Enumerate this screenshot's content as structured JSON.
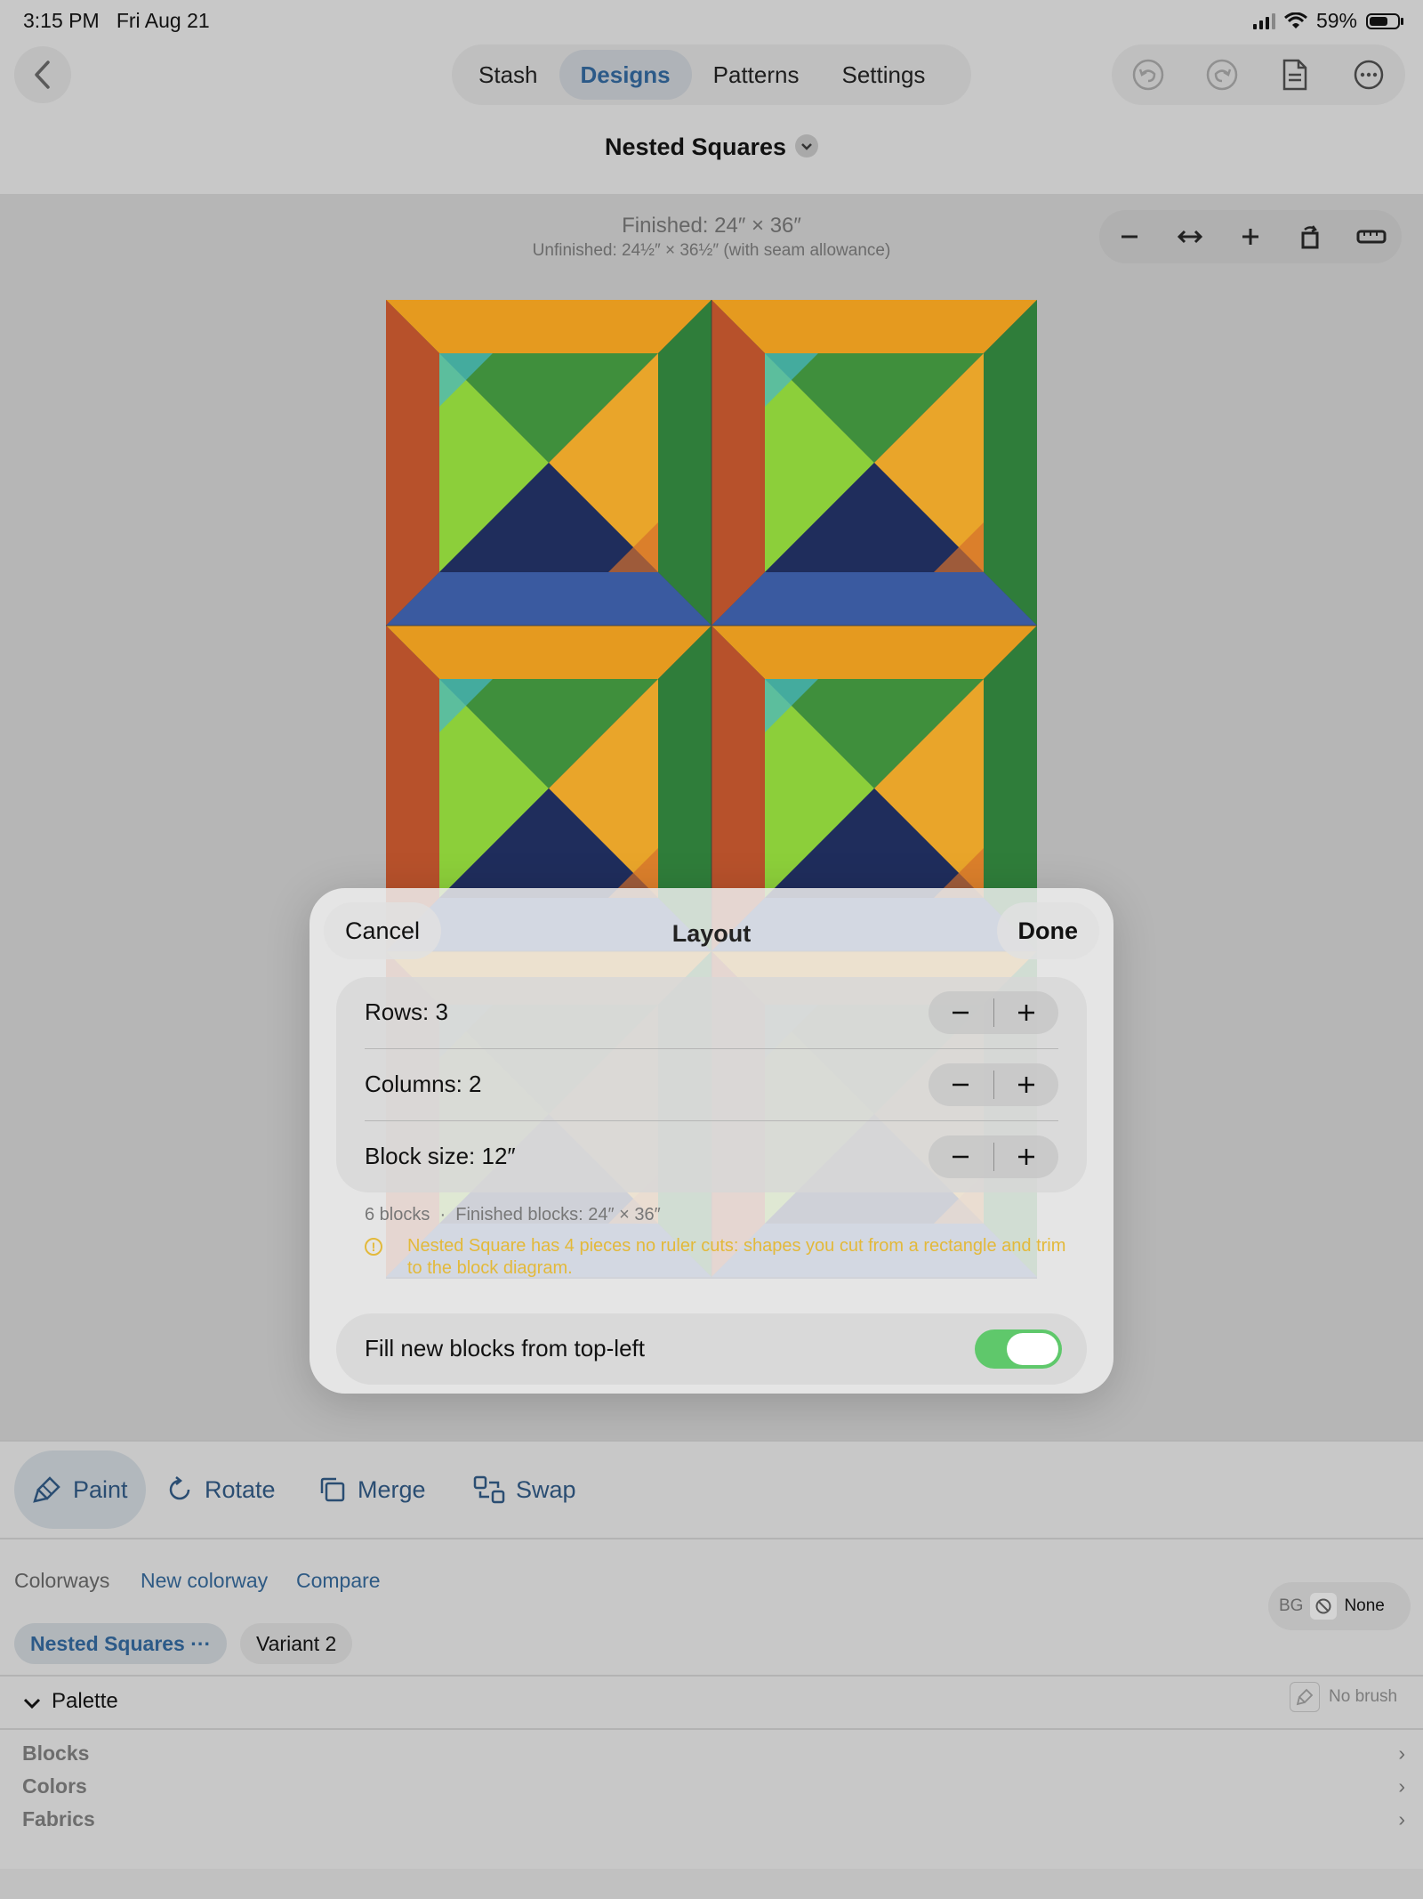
{
  "status": {
    "time": "3:15 PM",
    "date": "Fri Aug 21",
    "battery": "59%"
  },
  "nav": {
    "tabs": [
      {
        "label": "Stash",
        "active": false
      },
      {
        "label": "Designs",
        "active": true
      },
      {
        "label": "Patterns",
        "active": false
      },
      {
        "label": "Settings",
        "active": false
      }
    ]
  },
  "design": {
    "title": "Nested Squares",
    "finished": "Finished: 24″ × 36″",
    "unfinished": "Unfinished: 24½″ × 36½″ (with seam allowance)"
  },
  "modal": {
    "cancel": "Cancel",
    "title": "Layout",
    "done": "Done",
    "rows": [
      {
        "label": "Rows: 3"
      },
      {
        "label": "Columns: 2"
      },
      {
        "label": "Block size: 12″"
      }
    ],
    "summary_count": "6 blocks",
    "summary_finished": "Finished blocks: 24″ × 36″",
    "warning": "Nested Square has 4 pieces no ruler cuts: shapes you cut from a rectangle and trim to the block diagram.",
    "toggle_label": "Fill new blocks from top-left",
    "toggle_on": true,
    "accent": "#5fc86b"
  },
  "tools": {
    "paint": "Paint",
    "rotate": "Rotate",
    "merge": "Merge",
    "swap": "Swap"
  },
  "colorways": {
    "label": "Colorways",
    "new": "New colorway",
    "compare": "Compare",
    "bg_label": "BG",
    "bg_value": "None",
    "chips": [
      {
        "label": "Nested Squares ···",
        "active": true
      },
      {
        "label": "Variant 2",
        "active": false
      }
    ]
  },
  "palette": {
    "title": "Palette",
    "nobrush": "No brush",
    "items": [
      "Blocks",
      "Colors",
      "Fabrics"
    ]
  },
  "colors": {
    "link": "#2e5a84",
    "warning": "#e3b93a"
  }
}
